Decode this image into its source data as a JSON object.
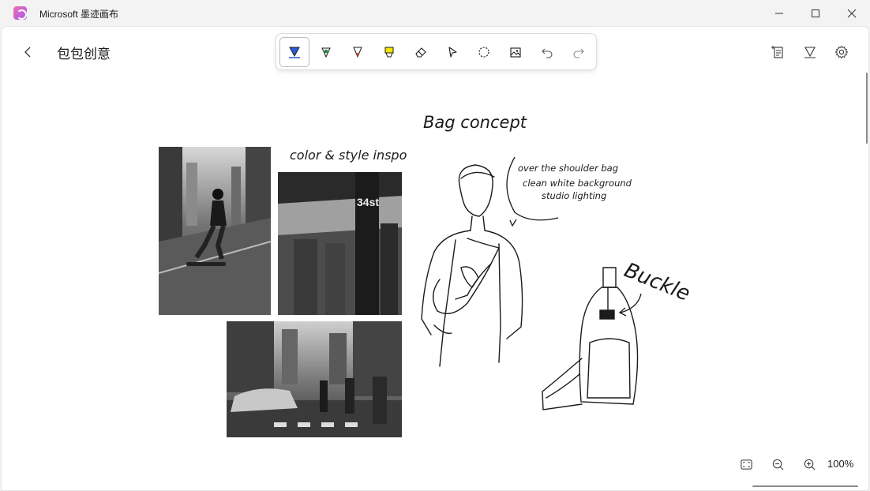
{
  "window": {
    "app_title": "Microsoft 墨迹画布",
    "controls": [
      "minimize-icon",
      "maximize-icon",
      "close-icon"
    ]
  },
  "header": {
    "page_title": "包包创意"
  },
  "toolbar": {
    "tools": [
      {
        "name": "ballpoint-pen",
        "icon": "pen-icon",
        "color": "#2a5bd7",
        "active": true
      },
      {
        "name": "pen-green",
        "icon": "pen-icon",
        "color": "#1f8a3b",
        "active": false
      },
      {
        "name": "pencil",
        "icon": "pencil-icon",
        "color": "#d9442e",
        "active": false
      },
      {
        "name": "highlighter",
        "icon": "highlighter-icon",
        "color": "#f2e600",
        "active": false
      },
      {
        "name": "eraser",
        "icon": "eraser-icon",
        "active": false
      },
      {
        "name": "select",
        "icon": "cursor-icon",
        "active": false
      },
      {
        "name": "lasso",
        "icon": "lasso-icon",
        "active": false
      },
      {
        "name": "insert-image",
        "icon": "image-icon",
        "active": false
      },
      {
        "name": "undo",
        "icon": "undo-icon",
        "active": false
      },
      {
        "name": "redo",
        "icon": "redo-icon",
        "active": false
      }
    ]
  },
  "top_right": [
    "add-page-icon",
    "pen-settings-icon",
    "gear-icon"
  ],
  "canvas": {
    "ink_notes": {
      "title": "Bag concept",
      "inspo": "color & style inspo",
      "note_line1": "over the shoulder bag",
      "note_line2": "clean white background",
      "note_line3": "studio lighting",
      "buckle": "Buckle"
    },
    "photos": [
      "skateboarder",
      "subway-34st",
      "city-crosswalk"
    ],
    "subway_sign": "34st"
  },
  "bottom": {
    "zoom": "100%",
    "buttons": [
      "fit-screen-icon",
      "zoom-out-icon",
      "zoom-in-icon"
    ]
  }
}
